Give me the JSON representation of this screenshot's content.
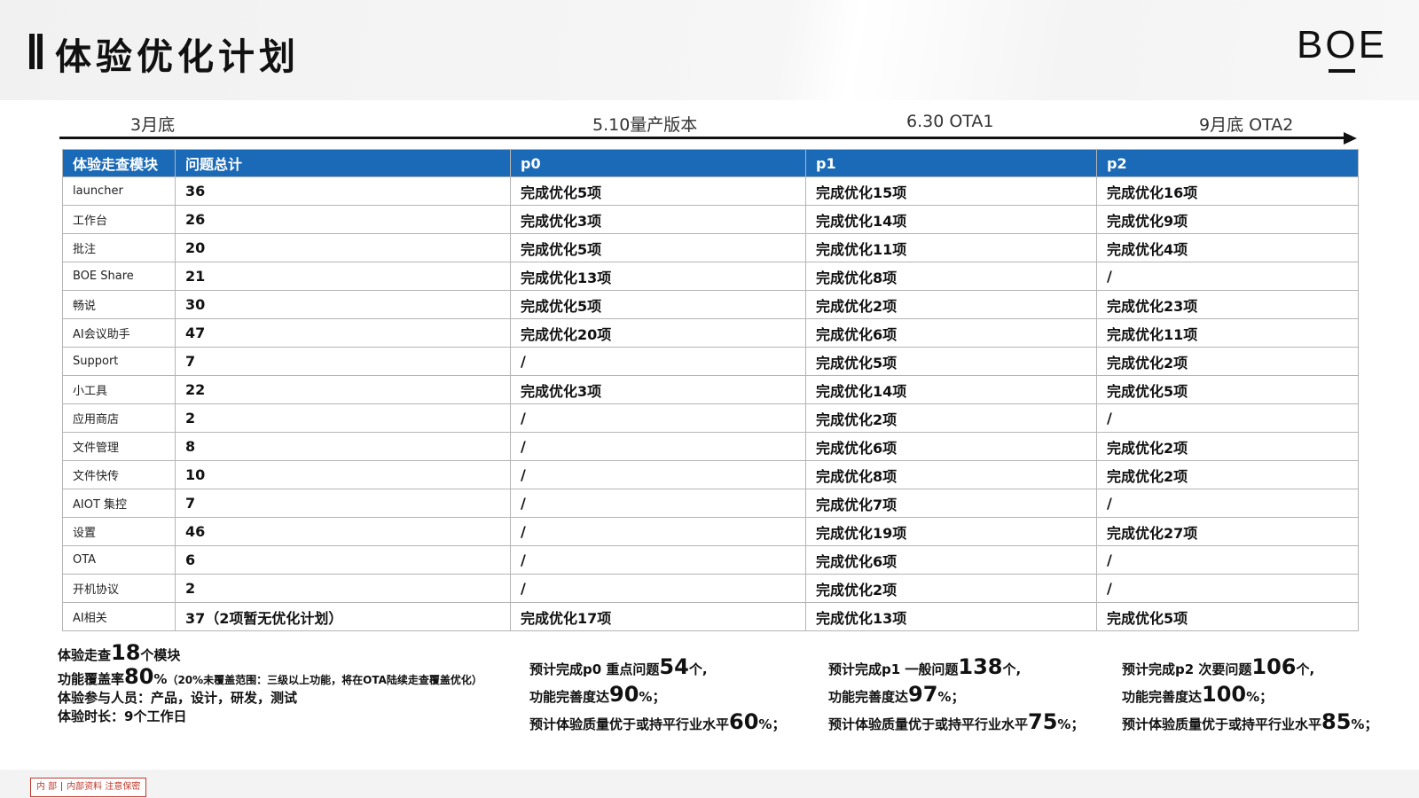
{
  "title": "体验优化计划",
  "logo": {
    "b": "B",
    "o": "O",
    "e": "E"
  },
  "timeline": {
    "march": "3月底",
    "may": "5.10量产版本",
    "june": "6.30 OTA1",
    "sept": "9月底 OTA2"
  },
  "table": {
    "headers": [
      "体验走查模块",
      "问题总计",
      "p0",
      "p1",
      "p2"
    ],
    "rows": [
      [
        "launcher",
        "36",
        "完成优化5项",
        "完成优化15项",
        "完成优化16项"
      ],
      [
        "工作台",
        "26",
        "完成优化3项",
        "完成优化14项",
        "完成优化9项"
      ],
      [
        "批注",
        "20",
        "完成优化5项",
        "完成优化11项",
        "完成优化4项"
      ],
      [
        "BOE Share",
        "21",
        "完成优化13项",
        "完成优化8项",
        "/"
      ],
      [
        "畅说",
        "30",
        "完成优化5项",
        "完成优化2项",
        "完成优化23项"
      ],
      [
        "AI会议助手",
        "47",
        "完成优化20项",
        "完成优化6项",
        "完成优化11项"
      ],
      [
        "Support",
        "7",
        "/",
        "完成优化5项",
        "完成优化2项"
      ],
      [
        "小工具",
        "22",
        "完成优化3项",
        "完成优化14项",
        "完成优化5项"
      ],
      [
        "应用商店",
        "2",
        "/",
        "完成优化2项",
        "/"
      ],
      [
        "文件管理",
        "8",
        "/",
        "完成优化6项",
        "完成优化2项"
      ],
      [
        "文件快传",
        "10",
        "/",
        "完成优化8项",
        "完成优化2项"
      ],
      [
        "AIOT 集控",
        "7",
        "/",
        "完成优化7项",
        "/"
      ],
      [
        "设置",
        "46",
        "/",
        "完成优化19项",
        "完成优化27项"
      ],
      [
        "OTA",
        "6",
        "/",
        "完成优化6项",
        "/"
      ],
      [
        "开机协议",
        "2",
        "/",
        "完成优化2项",
        "/"
      ],
      [
        "AI相关",
        "37（2项暂无优化计划）",
        "完成优化17项",
        "完成优化13项",
        "完成优化5项"
      ]
    ]
  },
  "summary": {
    "modules_pre": "体验走查",
    "modules_num": "18",
    "modules_post": "个模块",
    "coverage_pre": "功能覆盖率",
    "coverage_num": "80",
    "coverage_pct": "%",
    "coverage_note": "（20%未覆盖范围：三级以上功能，将在OTA陆续走查覆盖优化）",
    "participants": "体验参与人员：产品，设计，研发，测试",
    "duration": "体验时长：9个工作日"
  },
  "p0_summary": {
    "l1_pre": "预计完成p0 重点问题",
    "l1_num": "54",
    "l1_post": "个,",
    "l2_pre": "功能完善度达",
    "l2_num": "90",
    "l2_post": "%；",
    "l3_pre": "预计体验质量优于或持平行业水平",
    "l3_num": "60",
    "l3_post": "%；"
  },
  "p1_summary": {
    "l1_pre": "预计完成p1 一般问题",
    "l1_num": "138",
    "l1_post": "个,",
    "l2_pre": "功能完善度达",
    "l2_num": "97",
    "l2_post": "%；",
    "l3_pre": "预计体验质量优于或持平行业水平",
    "l3_num": "75",
    "l3_post": "%；"
  },
  "p2_summary": {
    "l1_pre": "预计完成p2 次要问题",
    "l1_num": "106",
    "l1_post": "个,",
    "l2_pre": "功能完善度达",
    "l2_num": "100",
    "l2_post": "%；",
    "l3_pre": "预计体验质量优于或持平行业水平",
    "l3_num": "85",
    "l3_post": "%；"
  },
  "footer": {
    "stamp_left": "内 部",
    "stamp_right": "内部资料 注意保密"
  },
  "colors": {
    "table_header": "#1a6ab8",
    "stamp": "#c0392b"
  }
}
